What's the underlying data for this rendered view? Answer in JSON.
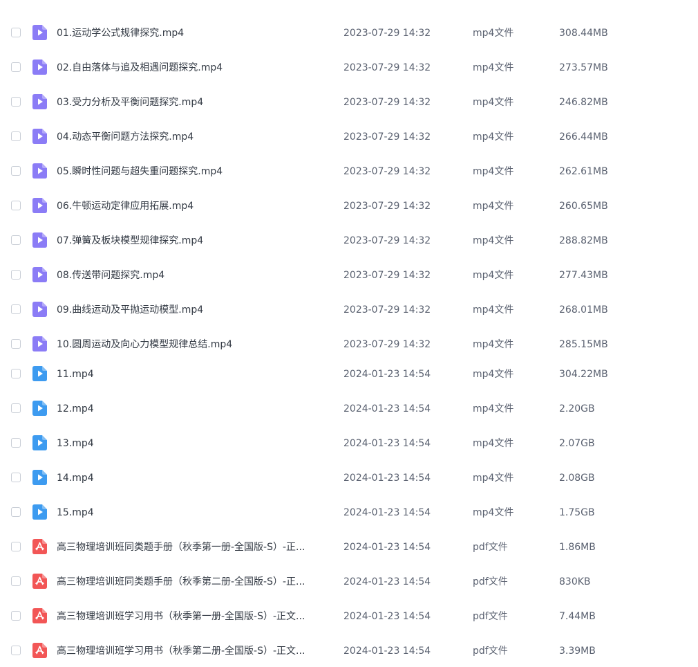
{
  "files": [
    {
      "name": "01.运动学公式规律探究.mp4",
      "date": "2023-07-29 14:32",
      "type": "mp4文件",
      "size": "308.44MB",
      "icon": "video-file-purple-icon"
    },
    {
      "name": "02.自由落体与追及相遇问题探究.mp4",
      "date": "2023-07-29 14:32",
      "type": "mp4文件",
      "size": "273.57MB",
      "icon": "video-file-purple-icon"
    },
    {
      "name": "03.受力分析及平衡问题探究.mp4",
      "date": "2023-07-29 14:32",
      "type": "mp4文件",
      "size": "246.82MB",
      "icon": "video-file-purple-icon"
    },
    {
      "name": "04.动态平衡问题方法探究.mp4",
      "date": "2023-07-29 14:32",
      "type": "mp4文件",
      "size": "266.44MB",
      "icon": "video-file-purple-icon"
    },
    {
      "name": "05.瞬时性问题与超失重问题探究.mp4",
      "date": "2023-07-29 14:32",
      "type": "mp4文件",
      "size": "262.61MB",
      "icon": "video-file-purple-icon"
    },
    {
      "name": "06.牛顿运动定律应用拓展.mp4",
      "date": "2023-07-29 14:32",
      "type": "mp4文件",
      "size": "260.65MB",
      "icon": "video-file-purple-icon"
    },
    {
      "name": "07.弹簧及板块模型规律探究.mp4",
      "date": "2023-07-29 14:32",
      "type": "mp4文件",
      "size": "288.82MB",
      "icon": "video-file-purple-icon"
    },
    {
      "name": "08.传送带问题探究.mp4",
      "date": "2023-07-29 14:32",
      "type": "mp4文件",
      "size": "277.43MB",
      "icon": "video-file-purple-icon"
    },
    {
      "name": "09.曲线运动及平抛运动模型.mp4",
      "date": "2023-07-29 14:32",
      "type": "mp4文件",
      "size": "268.01MB",
      "icon": "video-file-purple-icon"
    },
    {
      "name": "10.圆周运动及向心力模型规律总结.mp4",
      "date": "2023-07-29 14:32",
      "type": "mp4文件",
      "size": "285.15MB",
      "icon": "video-file-purple-icon"
    },
    {
      "name": "11.mp4",
      "date": "2024-01-23 14:54",
      "type": "mp4文件",
      "size": "304.22MB",
      "icon": "video-file-blue-icon"
    },
    {
      "name": "12.mp4",
      "date": "2024-01-23 14:54",
      "type": "mp4文件",
      "size": "2.20GB",
      "icon": "video-file-blue-icon"
    },
    {
      "name": "13.mp4",
      "date": "2024-01-23 14:54",
      "type": "mp4文件",
      "size": "2.07GB",
      "icon": "video-file-blue-icon"
    },
    {
      "name": "14.mp4",
      "date": "2024-01-23 14:54",
      "type": "mp4文件",
      "size": "2.08GB",
      "icon": "video-file-blue-icon"
    },
    {
      "name": "15.mp4",
      "date": "2024-01-23 14:54",
      "type": "mp4文件",
      "size": "1.75GB",
      "icon": "video-file-blue-icon"
    },
    {
      "name": "高三物理培训班同类题手册（秋季第一册-全国版-S）-正...",
      "date": "2024-01-23 14:54",
      "type": "pdf文件",
      "size": "1.86MB",
      "icon": "pdf-file-icon"
    },
    {
      "name": "高三物理培训班同类题手册（秋季第二册-全国版-S）-正...",
      "date": "2024-01-23 14:54",
      "type": "pdf文件",
      "size": "830KB",
      "icon": "pdf-file-icon"
    },
    {
      "name": "高三物理培训班学习用书（秋季第一册-全国版-S）-正文...",
      "date": "2024-01-23 14:54",
      "type": "pdf文件",
      "size": "7.44MB",
      "icon": "pdf-file-icon"
    },
    {
      "name": "高三物理培训班学习用书（秋季第二册-全国版-S）-正文...",
      "date": "2024-01-23 14:54",
      "type": "pdf文件",
      "size": "3.39MB",
      "icon": "pdf-file-icon"
    }
  ],
  "colors": {
    "video_purple": "#8b7cf6",
    "video_blue": "#3d9bf0",
    "pdf_red": "#f25656"
  }
}
